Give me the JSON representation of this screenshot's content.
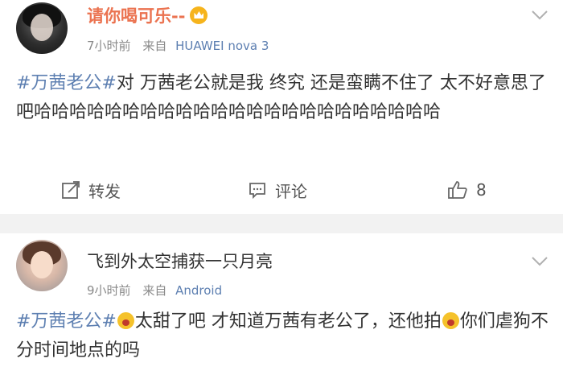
{
  "post1": {
    "username": "请你喝可乐--",
    "time": "7小时前",
    "source": "来自",
    "device": "HUAWEI nova 3",
    "tag": "#万茜老公#",
    "text": "对 万茜老公就是我 终究 还是蛮瞒不住了 太不好意思了吧哈哈哈哈哈哈哈哈哈哈哈哈哈哈哈哈哈哈哈哈哈哈哈",
    "actions": {
      "repost_label": "转发",
      "comment_label": "评论",
      "like_count": "8"
    }
  },
  "post2": {
    "username": "飞到外太空捕获一只月亮",
    "time": "9小时前",
    "source": "来自",
    "device": "Android",
    "tag": "#万茜老公#",
    "text_part1": "太甜了吧 才知道万茜有老公了，还他拍",
    "text_part2": "你们虐狗不分时间地点的吗"
  },
  "icons": {
    "badge": "vip-crown-icon",
    "menu": "chevron-down-icon",
    "repost": "repost-icon",
    "comment": "comment-icon",
    "like": "thumbs-up-icon",
    "emoji": "crying-laugh-emoji-icon"
  },
  "colors": {
    "username_vip": "#eb7350",
    "link": "#5d7fb1",
    "meta": "#8a8a8a",
    "divider": "#f2f2f2",
    "badge": "#f6b41c"
  }
}
